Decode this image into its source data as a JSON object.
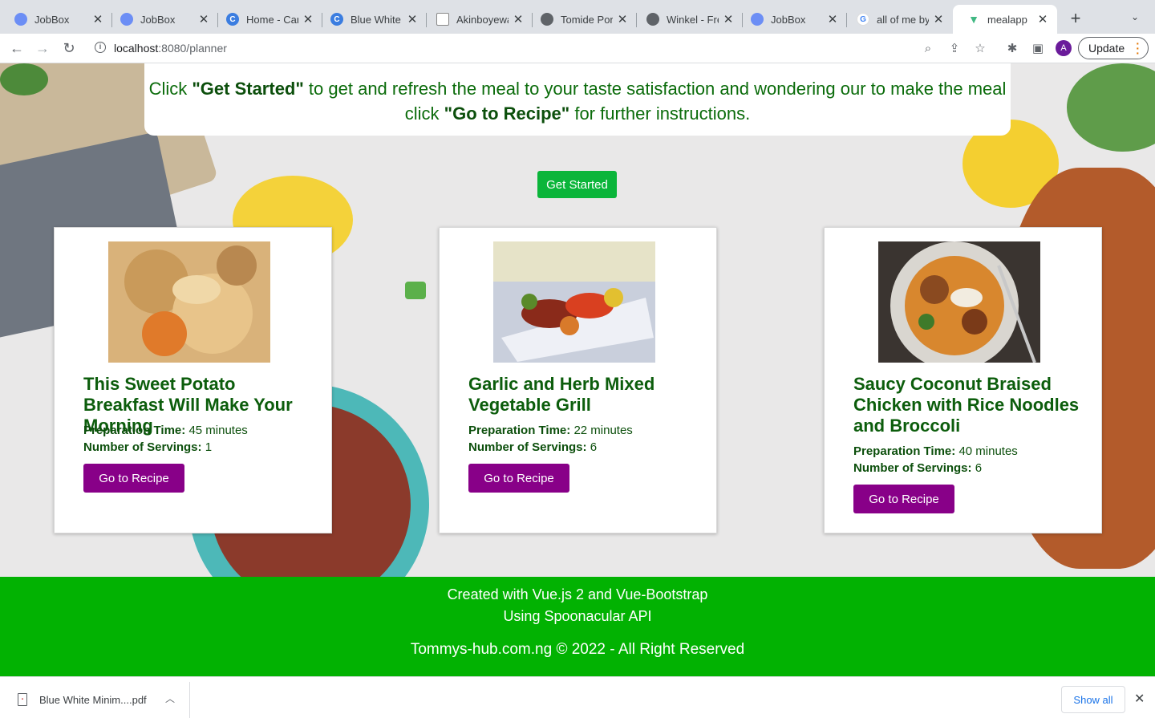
{
  "browser": {
    "tabs": [
      {
        "title": "JobBox",
        "favicon": "jobbox-icon",
        "active": false
      },
      {
        "title": "JobBox",
        "favicon": "jobbox-icon",
        "active": false
      },
      {
        "title": "Home - Canva",
        "favicon": "canva-icon",
        "active": false
      },
      {
        "title": "Blue White Minimalist",
        "favicon": "canva-icon",
        "active": false
      },
      {
        "title": "Akinboyewa",
        "favicon": "document-icon",
        "active": false
      },
      {
        "title": "Tomide Portfolio",
        "favicon": "globe-icon",
        "active": false
      },
      {
        "title": "Winkel - Free",
        "favicon": "globe-icon",
        "active": false
      },
      {
        "title": "JobBox",
        "favicon": "jobbox-icon",
        "active": false
      },
      {
        "title": "all of me by",
        "favicon": "google-icon",
        "active": false
      },
      {
        "title": "mealapp",
        "favicon": "vue-icon",
        "active": true
      }
    ],
    "url_host": "localhost",
    "url_rest": ":8080/planner",
    "profile_initial": "A",
    "update_label": "Update"
  },
  "page": {
    "intro_prefix": "Click ",
    "intro_get_started": "\"Get Started\"",
    "intro_middle": " to get and refresh the meal to your taste satisfaction and wondering our to make the meal click ",
    "intro_go_to_recipe": "\"Go to Recipe\"",
    "intro_suffix": " for further instructions.",
    "get_started_label": "Get Started",
    "prep_label": "Preparation Time:",
    "servings_label": "Number of Servings:",
    "recipe_button_label": "Go to Recipe",
    "recipes": [
      {
        "title": "This Sweet Potato Breakfast Will Make Your Morning",
        "prep_time": "45 minutes",
        "servings": "1"
      },
      {
        "title": "Garlic and Herb Mixed Vegetable Grill",
        "prep_time": "22 minutes",
        "servings": "6"
      },
      {
        "title": "Saucy Coconut Braised Chicken with Rice Noodles and Broccoli",
        "prep_time": "40 minutes",
        "servings": "6"
      }
    ]
  },
  "footer": {
    "line1": "Created with Vue.js 2 and Vue-Bootstrap",
    "line2": "Using Spoonacular API",
    "line3": "Tommys-hub.com.ng © 2022 - All Right Reserved"
  },
  "downloads": {
    "file_name": "Blue White Minim....pdf",
    "show_all_label": "Show all"
  }
}
